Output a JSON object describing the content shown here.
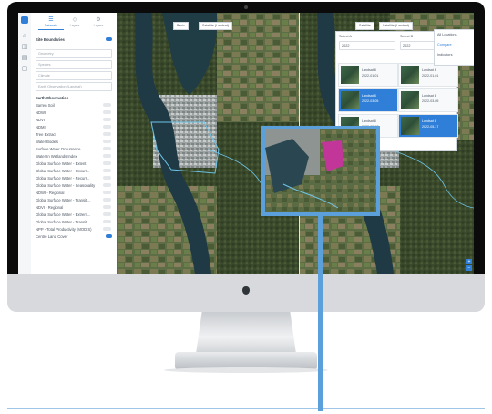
{
  "panel": {
    "tabs": [
      {
        "label": "Datasets",
        "icon": "database-icon"
      },
      {
        "label": "Layers",
        "icon": "layers-icon"
      },
      {
        "label": "Layers",
        "icon": "gear-icon"
      }
    ],
    "site_boundaries_label": "Site Boundaries",
    "fields": [
      "Geometry",
      "Species",
      "Climate",
      "Earth Observation (Landsat)"
    ],
    "section_title": "Earth Observation",
    "layers": [
      "Barren Soil",
      "NDWI",
      "NDVI",
      "NDMI",
      "Tree Extract",
      "Water Bodies",
      "Surface Water Occurrence",
      "Water In Wetlands Index",
      "Global Surface Water - Extent",
      "Global Surface Water - Occurr...",
      "Global Surface Water - Recurr...",
      "Global Surface Water - Seasonality",
      "NDWI - Regional",
      "Global Surface Water - Transiti...",
      "NDVI - Regional",
      "Global Surface Water - Extrem...",
      "Global Surface Water - Transit...",
      "NPP - Total Productivity (MODIS)",
      "Centre Land Cover"
    ]
  },
  "map": {
    "left_buttons": [
      "Basic",
      "Satellite (Landsat)"
    ],
    "right_buttons": [
      "Satellite",
      "Satellite (Landsat)"
    ],
    "selector": {
      "columns": [
        {
          "label": "Select A",
          "year": "2022"
        },
        {
          "label": "Select B",
          "year": "2022"
        }
      ],
      "thumbs": [
        {
          "t1": "Landsat 8",
          "t2": "2022-01-01",
          "selected": false
        },
        {
          "t1": "Landsat 8",
          "t2": "2022-01-01",
          "selected": false
        },
        {
          "t1": "Landsat 8",
          "t2": "2022-03-05",
          "selected": true
        },
        {
          "t1": "Landsat 8",
          "t2": "2022-03-05",
          "selected": false
        },
        {
          "t1": "Landsat 8",
          "t2": "2022-05-17",
          "selected": false
        },
        {
          "t1": "Landsat 8",
          "t2": "2022-05-17",
          "selected": true
        }
      ]
    },
    "right_layers": [
      "All Locations",
      "Compare",
      "Indicators"
    ]
  }
}
